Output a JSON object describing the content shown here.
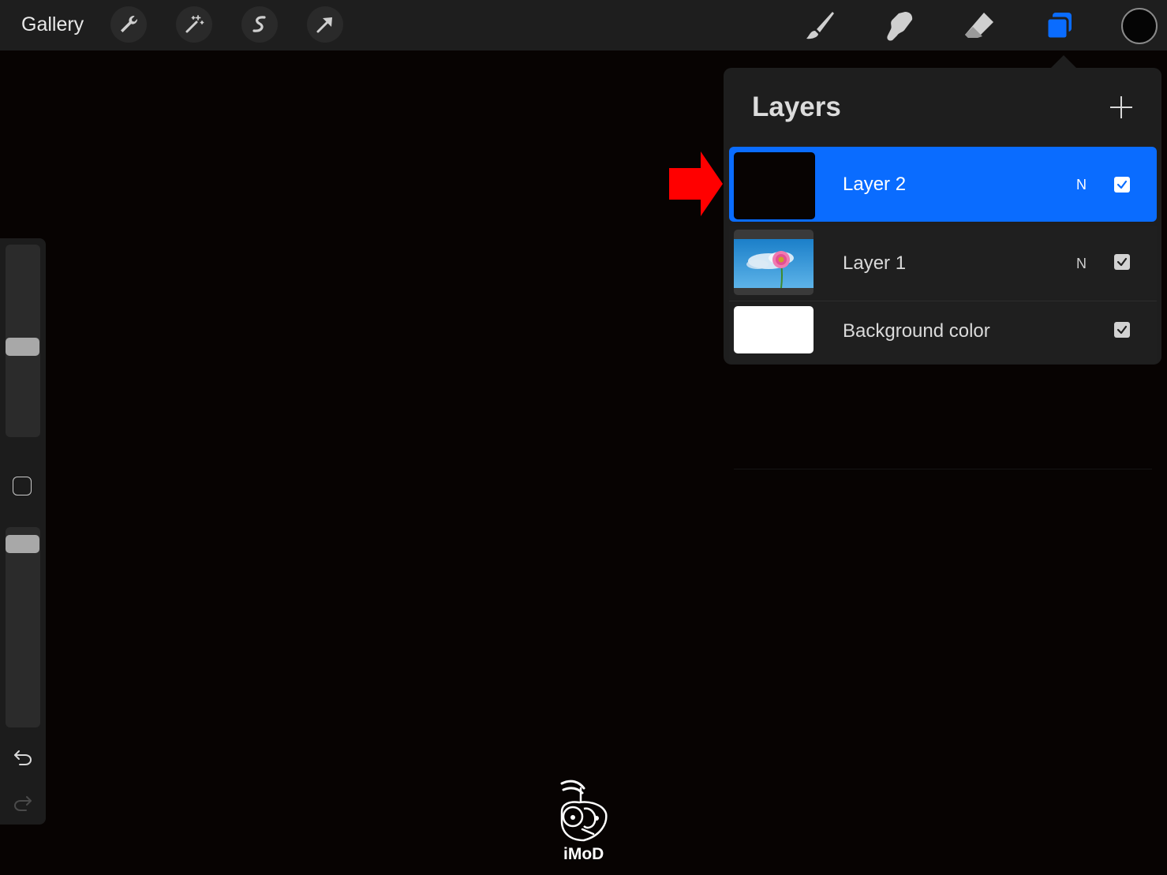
{
  "toolbar": {
    "gallery_label": "Gallery",
    "left_tools": [
      "wrench-icon",
      "magic-wand-icon",
      "selection-icon",
      "transform-arrow-icon"
    ],
    "right_tools": [
      "brush-icon",
      "smudge-icon",
      "eraser-icon",
      "layers-icon"
    ],
    "active_tool": "layers-icon",
    "current_color": "#050505",
    "accent": "#0a6cff"
  },
  "sidebar": {
    "brush_size_fraction": 0.55,
    "opacity_fraction": 0.85,
    "icons": [
      "modify-square-icon",
      "undo-icon",
      "redo-icon"
    ]
  },
  "layers_panel": {
    "title": "Layers",
    "add_icon": "plus-icon",
    "layers": [
      {
        "name": "Layer 2",
        "blend": "N",
        "visible": true,
        "selected": true,
        "thumb": "black"
      },
      {
        "name": "Layer 1",
        "blend": "N",
        "visible": true,
        "selected": false,
        "thumb": "flower-sky"
      },
      {
        "name": "Background color",
        "blend": "",
        "visible": true,
        "selected": false,
        "thumb": "white"
      }
    ]
  },
  "annotation": {
    "arrow_color": "#ff0000"
  },
  "watermark": {
    "text": "iMoD"
  }
}
